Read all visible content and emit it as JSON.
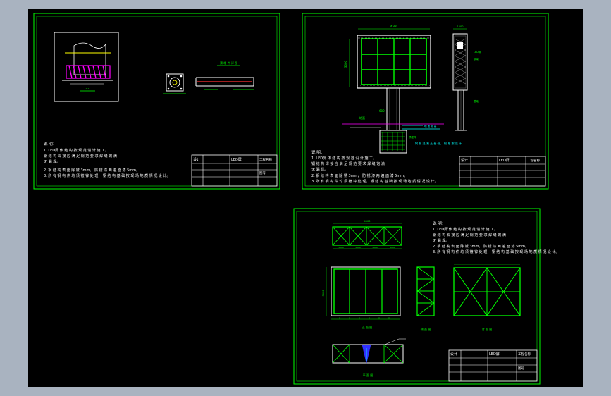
{
  "colors": {
    "frame": "#00ff00",
    "line_white": "#ffffff",
    "line_cyan": "#00ffff",
    "line_magenta": "#ff00ff",
    "line_red": "#ff3030",
    "line_yellow": "#ffff00",
    "line_blue": "#3030ff",
    "background": "#000000",
    "surround": "#a9b3c0"
  },
  "notes": {
    "heading": "说 明：",
    "line1": "1. LED屏   体   结   构   按   规   范   设   计   施   工。",
    "line2": "    钢   结   构   焊   接   应   满   足   规   范   要   求   焊   缝   饱   满",
    "line3": "    无   漏   焊。",
    "line4": "2. 钢   结   构   表   面   除   锈   3mm，   防   锈   漆   两   遍   面   漆   5mm。",
    "line5": "3. 所   有   钢   构   件   均   须   镀   锌   处   理，   钢   结   构   基   础   按   现   场   地   质   情   况   设   计。"
  },
  "title_block": {
    "label_a": "设计",
    "label_b": "LED屏",
    "label_c": "工程名称",
    "label_d": "图号"
  },
  "panel2": {
    "dim_width": "4500",
    "dim_height": "3000",
    "dim_pole": "600",
    "label_a": "LED屏",
    "label_b": "基础",
    "label_c": "地面",
    "label_d": "预埋件",
    "note_ground": "地 面 标 高",
    "note_base": "钢 筋 混 凝 土 基 础，  规 格  按 设 计"
  },
  "panel1": {
    "callout": "预 埋 件 详 图"
  },
  "panel3": {
    "dim_top": "4500",
    "dim_side": "3000",
    "seg": "1000",
    "caption_front": "正 面 图",
    "caption_side": "侧 面 图",
    "caption_back": "背 面 图",
    "caption_plan": "平 面 图"
  }
}
